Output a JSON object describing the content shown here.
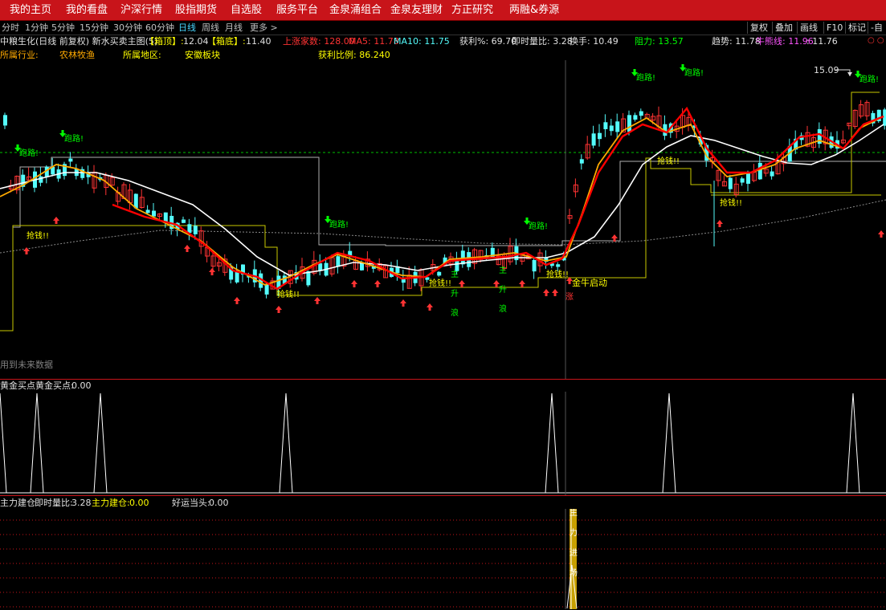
{
  "nav": {
    "items": [
      "我的主页",
      "我的看盘",
      "沪深行情",
      "股指期货",
      "自选股",
      "服务平台",
      "金泉涌组合",
      "金泉友理财",
      "方正研究",
      "两融&券源"
    ]
  },
  "periods": {
    "items": [
      "分时",
      "1分钟",
      "5分钟",
      "15分钟",
      "30分钟",
      "60分钟",
      "日线",
      "周线",
      "月线",
      "更多 >"
    ],
    "active": "日线"
  },
  "tools": [
    "复权",
    "叠加",
    "画线",
    "F10",
    "标记",
    "-自"
  ],
  "info": {
    "stock": "中粮生化(日线 前复权) 新水买卖主图(5)",
    "box_top_label": "【箱顶】:",
    "box_top_value": "12.04",
    "box_bottom_label": "【箱底】:",
    "box_bottom_value": "11.40",
    "up_count": "上涨家数: 128.00",
    "ma5": "MA5: 11.78",
    "ma10": "MA10: 11.75",
    "profit": "获利%: 69.70",
    "volume_ratio": "即时量比: 3.28",
    "turnover": "换手: 10.49",
    "resistance": "阻力: 13.57",
    "trend": "趋势: 11.78",
    "bull_bear": "牛熊线: 11.96",
    "bull_bear_2": ": 11.76",
    "industry_label": "所属行业:",
    "industry": "农林牧渔",
    "region_label": "所属地区:",
    "region": "安徽板块",
    "profit_ratio": "获利比例: 86.240",
    "future_note": "用到未来数据"
  },
  "annotations": {
    "run": "跑路!",
    "grab": "抢钱!!",
    "start": "金牛启动",
    "main_wave_1": "主",
    "main_wave_2": "升",
    "main_wave_3": "浪",
    "limit": "涨",
    "peak": "15.09",
    "inflow_1": "主",
    "inflow_2": "力",
    "inflow_3": "进",
    "inflow_4": "场"
  },
  "colors": {
    "up": "#ff3333",
    "down": "#54fcfc",
    "ma_red": "#ff0000",
    "ma_orange": "#ffaa00",
    "ma_white": "#ffffff",
    "box_line": "#c8c800",
    "green_text": "#00ff00",
    "yellow_text": "#ffff00"
  },
  "panel2": {
    "title": "黄金买点",
    "label": "黄金买点:",
    "value": "0.00"
  },
  "panel3": {
    "title": "主力建仓",
    "vr_label": "即时量比:",
    "vr_value": "3.28",
    "build_label": "主力建仓:",
    "build_value": "0.00",
    "luck_label": "好运当头:",
    "luck_value": "0.00"
  }
}
